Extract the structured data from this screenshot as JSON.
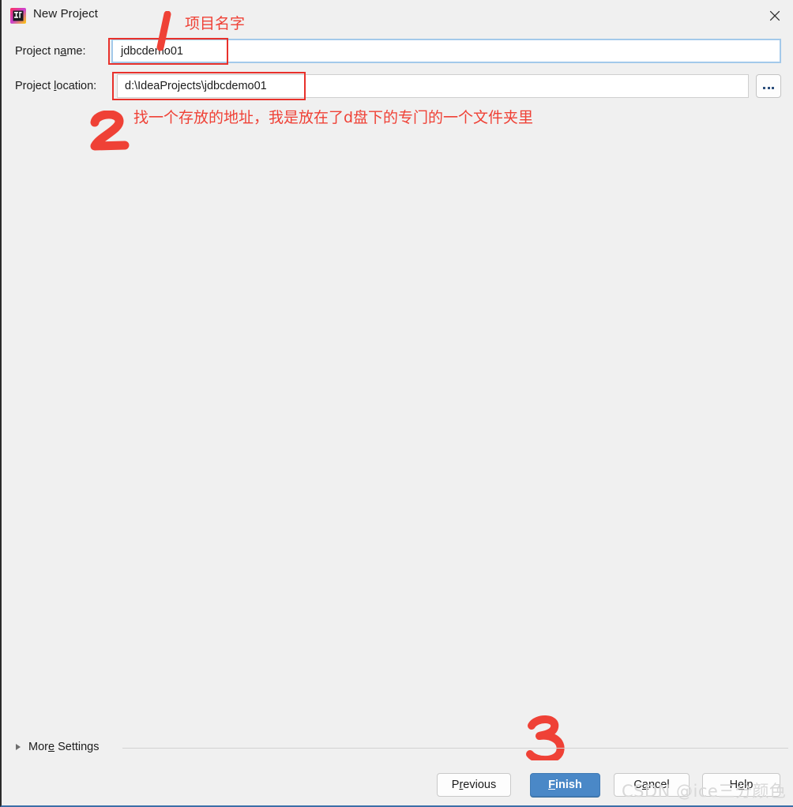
{
  "window": {
    "title": "New Project",
    "app_icon": "intellij-idea-icon",
    "close_icon": "close-icon"
  },
  "form": {
    "name_label_pre": "Project n",
    "name_label_mnemonic": "a",
    "name_label_post": "me:",
    "name_value": "jdbcdemo01",
    "location_label_pre": "Project ",
    "location_label_mnemonic": "l",
    "location_label_post": "ocation:",
    "location_value": "d:\\IdeaProjects\\jdbcdemo01",
    "browse_label": "...",
    "browse_icon": "ellipsis-icon"
  },
  "more_settings": {
    "label": "More Settings",
    "mnemonic": "e",
    "label_pre": "Mor",
    "label_post": " Settings",
    "expander_icon": "chevron-right-icon",
    "expanded": false
  },
  "buttons": {
    "previous_pre": "P",
    "previous_mnemonic": "r",
    "previous_post": "evious",
    "finish_mnemonic": "F",
    "finish_post": "inish",
    "cancel_pre": "C",
    "cancel_mnemonic": "a",
    "cancel_post": "ncel",
    "help_pre": "H",
    "help_mnemonic": "e",
    "help_post": "lp"
  },
  "annotations": {
    "mark_1": "1",
    "mark_2": "2",
    "mark_3": "3",
    "text_1": "项目名字",
    "text_2": "找一个存放的地址，我是放在了d盘下的专门的一个文件夹里",
    "color": "#ef4136"
  },
  "watermark": {
    "text": "CSDN @ice三分颜色"
  },
  "colors": {
    "dialog_bg": "#f0f0f0",
    "focus_border": "#a3c9ea",
    "primary_button": "#4a88c7",
    "annotation_red": "#ef4136",
    "text": "#1c1c1c"
  }
}
